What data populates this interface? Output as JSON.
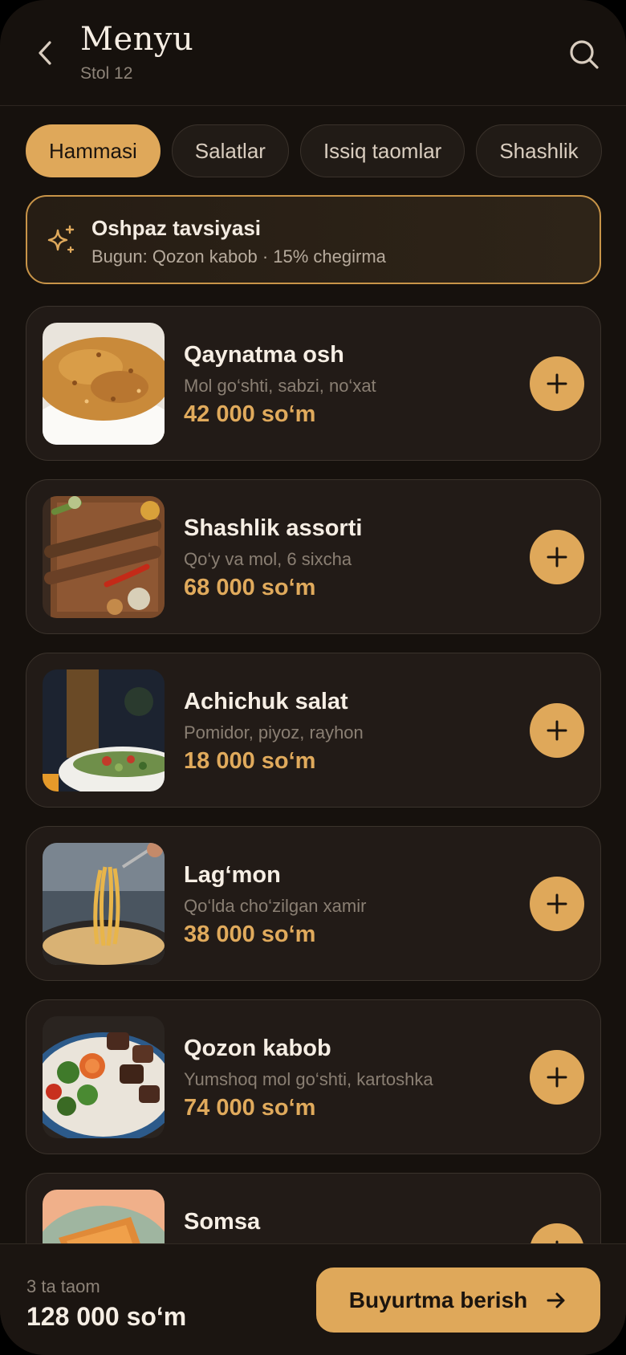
{
  "header": {
    "title": "Menyu",
    "subtitle": "Stol 12",
    "back_icon": "chevron-left-icon",
    "search_icon": "search-icon"
  },
  "categories": [
    {
      "label": "Hammasi",
      "active": true
    },
    {
      "label": "Salatlar",
      "active": false
    },
    {
      "label": "Issiq taomlar",
      "active": false
    },
    {
      "label": "Shashlik",
      "active": false
    }
  ],
  "promo": {
    "icon": "sparkles-icon",
    "title": "Oshpaz tavsiyasi",
    "subtitle": "Bugun: Qozon kabob · 15% chegirma"
  },
  "items": [
    {
      "name": "Qaynatma osh",
      "desc": "Mol go‘shti, sabzi, no‘xat",
      "price": "42 000 so‘m"
    },
    {
      "name": "Shashlik assorti",
      "desc": "Qo‘y va mol, 6 sixcha",
      "price": "68 000 so‘m"
    },
    {
      "name": "Achichuk salat",
      "desc": "Pomidor, piyoz, rayhon",
      "price": "18 000 so‘m"
    },
    {
      "name": "Lag‘mon",
      "desc": "Qo‘lda cho‘zilgan xamir",
      "price": "38 000 so‘m"
    },
    {
      "name": "Qozon kabob",
      "desc": "Yumshoq mol go‘shti, kartoshka",
      "price": "74 000 so‘m"
    },
    {
      "name": "Somsa",
      "desc": "",
      "price": ""
    }
  ],
  "footer": {
    "count": "3 ta taom",
    "total": "128 000 so‘m",
    "order_label": "Buyurtma berish",
    "order_icon": "arrow-right-icon"
  },
  "colors": {
    "accent": "#dfa85a",
    "background": "#16110d",
    "card": "#221b17"
  }
}
